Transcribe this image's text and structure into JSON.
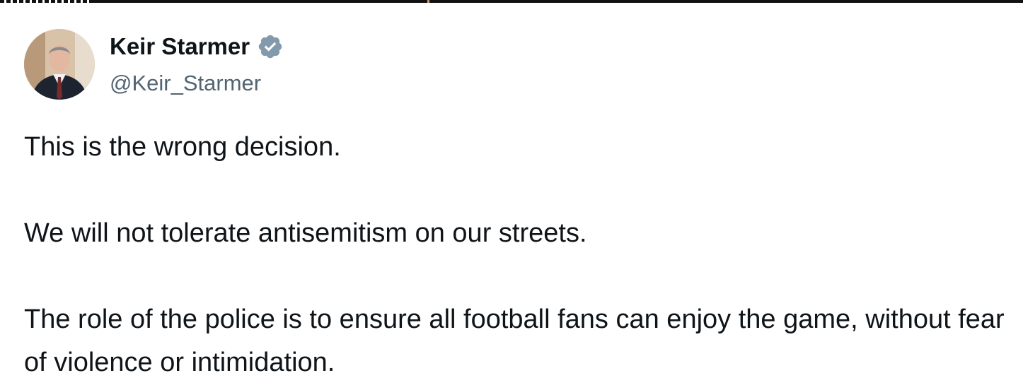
{
  "tweet": {
    "author": {
      "display_name": "Keir Starmer",
      "handle": "@Keir_Starmer",
      "verified": true,
      "verified_icon": "verified-badge-icon"
    },
    "paragraphs": [
      "This is the wrong decision.",
      "We will not tolerate antisemitism on our streets.",
      "The role of the police is to ensure all football fans can enjoy the game, without fear of violence or intimidation."
    ]
  },
  "colors": {
    "text": "#0f1419",
    "handle": "#536471",
    "verified_badge": "#829aab"
  }
}
